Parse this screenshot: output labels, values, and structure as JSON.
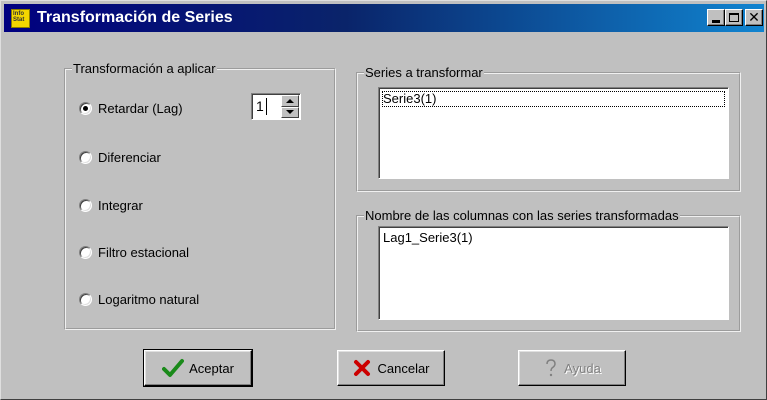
{
  "window": {
    "title": "Transformación de Series",
    "app_icon": {
      "name": "infostat-icon",
      "text": "Info Stat",
      "color": "#f3d600"
    },
    "controls": {
      "minimize": "minimize",
      "maximize": "maximize",
      "close": "close"
    },
    "titlebar_color": "#000080"
  },
  "transform_group": {
    "legend": "Transformación a aplicar",
    "options": [
      {
        "label": "Retardar (Lag)",
        "selected": true
      },
      {
        "label": "Diferenciar",
        "selected": false
      },
      {
        "label": "Integrar",
        "selected": false
      },
      {
        "label": "Filtro estacional",
        "selected": false
      },
      {
        "label": "Logaritmo natural",
        "selected": false
      }
    ],
    "lag_value": "1"
  },
  "series_group": {
    "legend": "Series a transformar",
    "items": [
      "Serie3(1)"
    ]
  },
  "names_group": {
    "legend": "Nombre de las columnas con las series transformadas",
    "items": [
      "Lag1_Serie3(1)"
    ]
  },
  "buttons": {
    "ok": {
      "label": "Aceptar",
      "icon": "check-icon",
      "color": "#1a8a1a"
    },
    "cancel": {
      "label": "Cancelar",
      "icon": "x-icon",
      "color": "#cc0000"
    },
    "help": {
      "label": "Ayuda",
      "icon": "question-icon",
      "enabled": false
    }
  }
}
